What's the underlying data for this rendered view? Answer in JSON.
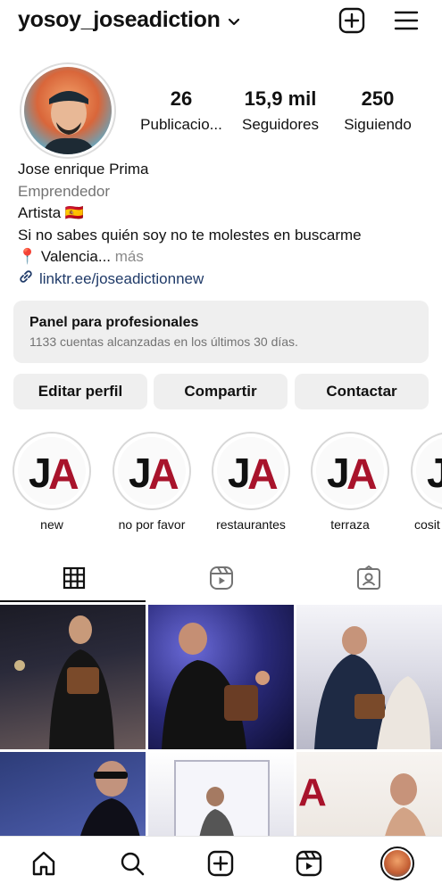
{
  "header": {
    "username": "yosoy_joseadiction"
  },
  "stats": [
    {
      "num": "26",
      "label": "Publicacio..."
    },
    {
      "num": "15,9 mil",
      "label": "Seguidores"
    },
    {
      "num": "250",
      "label": "Siguiendo"
    }
  ],
  "bio": {
    "name": "Jose enrique Prima",
    "category": "Emprendedor",
    "line1": "Artista 🇪🇸",
    "line2": "Si no sabes quién soy no te molestes en buscarme",
    "location": "📍 Valencia",
    "ellipsis": "...",
    "more": "más",
    "link": "linktr.ee/joseadictionnew"
  },
  "panel": {
    "title": "Panel para profesionales",
    "subtitle": "1133 cuentas alcanzadas en los últimos 30 días."
  },
  "buttons": {
    "edit": "Editar perfil",
    "share": "Compartir",
    "contact": "Contactar"
  },
  "highlights": [
    {
      "label": "new"
    },
    {
      "label": "no por favor"
    },
    {
      "label": "restaurantes"
    },
    {
      "label": "terraza"
    },
    {
      "label": "cosit"
    }
  ],
  "highlight_logo_text": "JA",
  "tabs": [
    "grid-icon",
    "reels-icon",
    "tagged-icon"
  ],
  "nav": [
    "home-icon",
    "search-icon",
    "create-icon",
    "reels-icon",
    "profile-avatar"
  ],
  "colors": {
    "accent": "#111111",
    "link": "#1f3a68",
    "muted": "#737373",
    "logo_red": "#a8132b"
  }
}
